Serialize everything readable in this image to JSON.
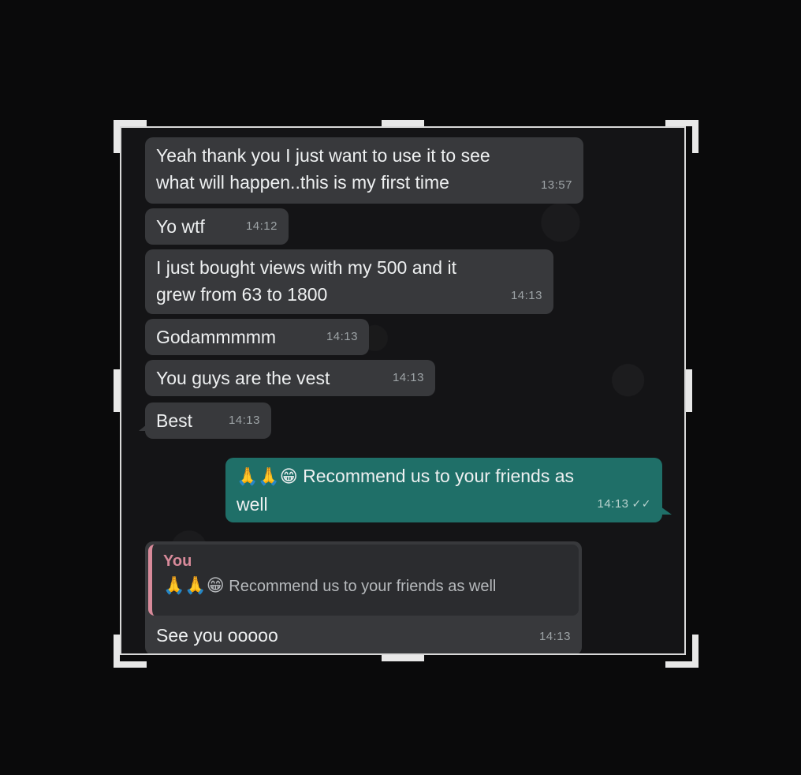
{
  "messages": [
    {
      "direction": "incoming",
      "text_line1": "Yeah thank you I just want to use it to see",
      "text_line2": "what will happen..this is my first time",
      "time": "13:57"
    },
    {
      "direction": "incoming",
      "text": "Yo wtf",
      "time": "14:12"
    },
    {
      "direction": "incoming",
      "text_line1": "I just bought views with my 500 and it",
      "text_line2": "grew from 63 to 1800",
      "time": "14:13"
    },
    {
      "direction": "incoming",
      "text": "Godammmmm",
      "time": "14:13"
    },
    {
      "direction": "incoming",
      "text": "You guys are the vest",
      "time": "14:13"
    },
    {
      "direction": "incoming",
      "text": "Best",
      "time": "14:13"
    },
    {
      "direction": "outgoing",
      "emoji": "🙏🙏😁",
      "text_line1": "Recommend us to your friends as",
      "text_line2": "well",
      "time": "14:13",
      "status": "✓✓"
    },
    {
      "direction": "incoming",
      "quote_author": "You",
      "quote_emoji": "🙏🙏😁",
      "quote_text": "Recommend us to your friends as well",
      "text": "See you ooooo",
      "time": "14:13"
    }
  ],
  "colors": {
    "incoming_bubble": "#38393c",
    "outgoing_bubble": "#1f6f68",
    "quote_accent": "#d88a9a",
    "background": "#0a0a0b"
  }
}
